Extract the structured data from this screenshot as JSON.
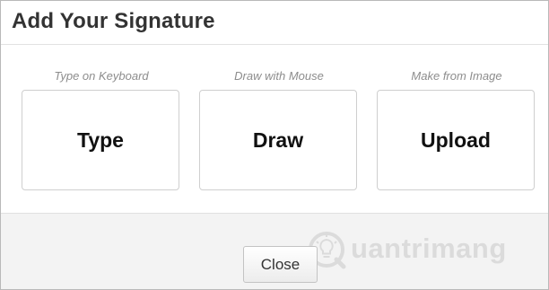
{
  "dialog": {
    "title": "Add Your Signature"
  },
  "options": [
    {
      "caption": "Type on Keyboard",
      "label": "Type"
    },
    {
      "caption": "Draw with Mouse",
      "label": "Draw"
    },
    {
      "caption": "Make from Image",
      "label": "Upload"
    }
  ],
  "footer": {
    "close_label": "Close"
  },
  "watermark": {
    "text": "uantrimang",
    "icon": "lightbulb-q-logo",
    "color": "#c9c9c9"
  }
}
